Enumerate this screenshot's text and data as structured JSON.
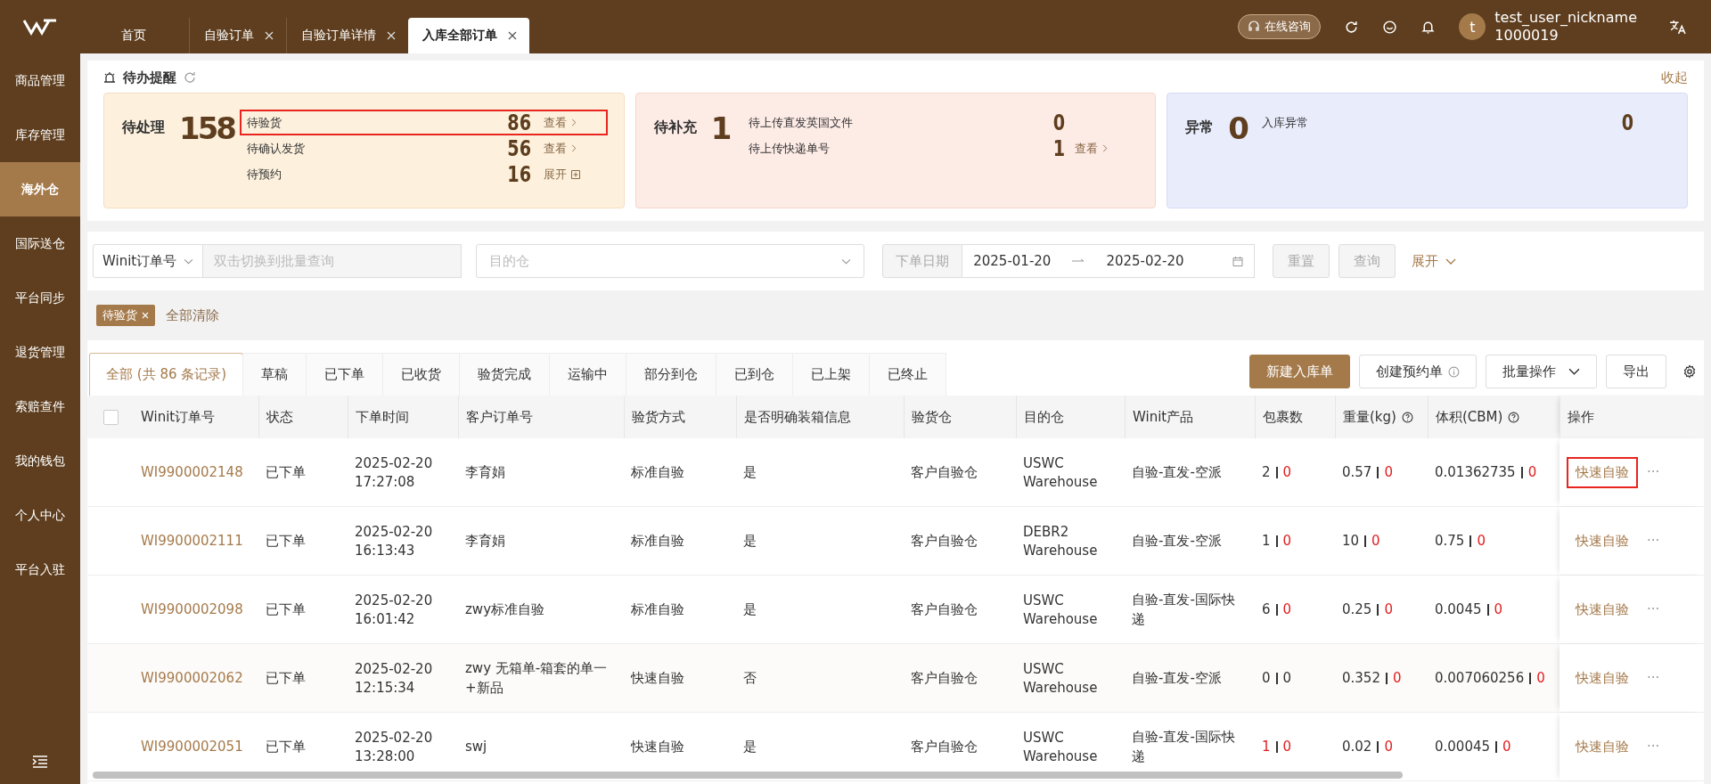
{
  "topbar": {
    "tabs": [
      {
        "label": "首页",
        "closable": false,
        "selected": false
      },
      {
        "label": "自验订单",
        "closable": true,
        "selected": false
      },
      {
        "label": "自验订单详情",
        "closable": true,
        "selected": false
      },
      {
        "label": "入库全部订单",
        "closable": true,
        "selected": true
      }
    ],
    "consult": "在线咨询",
    "user": {
      "avatar": "t",
      "name": "test_user_nickname",
      "id": "1000019"
    }
  },
  "sidebar": {
    "items": [
      {
        "label": "商品管理",
        "selected": false
      },
      {
        "label": "库存管理",
        "selected": false
      },
      {
        "label": "海外仓",
        "selected": true
      },
      {
        "label": "国际送仓",
        "selected": false
      },
      {
        "label": "平台同步",
        "selected": false
      },
      {
        "label": "退货管理",
        "selected": false
      },
      {
        "label": "索赔查件",
        "selected": false
      },
      {
        "label": "我的钱包",
        "selected": false
      },
      {
        "label": "个人中心",
        "selected": false
      },
      {
        "label": "平台入驻",
        "selected": false
      }
    ]
  },
  "todo": {
    "title": "待办提醒",
    "collapse": "收起",
    "cards": [
      {
        "kind": "pending",
        "label": "待处理",
        "total": "158",
        "items": [
          {
            "label": "待验货",
            "count": "86",
            "action": "查看",
            "kind": "view",
            "highlighted": true
          },
          {
            "label": "待确认发货",
            "count": "56",
            "action": "查看",
            "kind": "view",
            "highlighted": false
          },
          {
            "label": "待预约",
            "count": "16",
            "action": "展开",
            "kind": "expand",
            "highlighted": false
          }
        ]
      },
      {
        "kind": "supplement",
        "label": "待补充",
        "total": "1",
        "items": [
          {
            "label": "待上传直发英国文件",
            "count": "0",
            "highlighted": false
          },
          {
            "label": "待上传快递单号",
            "count": "1",
            "action": "查看",
            "kind": "view",
            "highlighted": false
          }
        ]
      },
      {
        "kind": "exception",
        "label": "异常",
        "total": "0",
        "items": [
          {
            "label": "入库异常",
            "count": "0",
            "highlighted": false
          }
        ]
      }
    ]
  },
  "filters": {
    "field_select": "Winit订单号",
    "search_placeholder": "双击切换到批量查询",
    "warehouse_placeholder": "目的仓",
    "date_label": "下单日期",
    "date_start": "2025-01-20",
    "date_end": "2025-02-20",
    "reset": {
      "label": "重置",
      "disabled": true
    },
    "query": {
      "label": "查询",
      "disabled": true
    },
    "expand": "展开"
  },
  "active_tags": [
    {
      "label": "待验货"
    }
  ],
  "clear_all": "全部清除",
  "status_tabs": [
    {
      "label": "全部 (共 86 条记录)",
      "selected": true
    },
    {
      "label": "草稿",
      "selected": false
    },
    {
      "label": "已下单",
      "selected": false
    },
    {
      "label": "已收货",
      "selected": false
    },
    {
      "label": "验货完成",
      "selected": false
    },
    {
      "label": "运输中",
      "selected": false
    },
    {
      "label": "部分到仓",
      "selected": false
    },
    {
      "label": "已到仓",
      "selected": false
    },
    {
      "label": "已上架",
      "selected": false
    },
    {
      "label": "已终止",
      "selected": false
    }
  ],
  "actions": [
    {
      "label": "新建入库单",
      "kind": "primary"
    },
    {
      "label": "创建预约单",
      "kind": "info"
    },
    {
      "label": "批量操作",
      "kind": "dropdown"
    },
    {
      "label": "导出",
      "kind": "plain"
    }
  ],
  "table": {
    "select_all": {
      "checked": false
    },
    "columns": [
      {
        "label": "Winit订单号",
        "help": false
      },
      {
        "label": "状态",
        "help": false
      },
      {
        "label": "下单时间",
        "help": false
      },
      {
        "label": "客户订单号",
        "help": false
      },
      {
        "label": "验货方式",
        "help": false
      },
      {
        "label": "是否明确装箱信息",
        "help": false
      },
      {
        "label": "验货仓",
        "help": false
      },
      {
        "label": "目的仓",
        "help": false
      },
      {
        "label": "Winit产品",
        "help": false
      },
      {
        "label": "包裹数",
        "help": false
      },
      {
        "label": "重量(kg)",
        "help": true
      },
      {
        "label": "体积(CBM)",
        "help": true
      },
      {
        "label": "操作",
        "help": false
      }
    ],
    "rows": [
      {
        "order": "WI9900002148",
        "status": "已下单",
        "date": "2025-02-20",
        "time": "17:27:08",
        "customer": "李育娟",
        "method": "标准自验",
        "box_info": "是",
        "inspect_wh": "客户自验仓",
        "dest": "USWC",
        "dest_sub": "Warehouse",
        "product": "自验-直发-空派",
        "parcels": [
          {
            "text": "2",
            "alert": false
          },
          {
            "text": "0",
            "alert": true
          }
        ],
        "weight": [
          {
            "text": "0.57",
            "alert": false
          },
          {
            "text": "0",
            "alert": true
          }
        ],
        "volume": [
          {
            "text": "0.01362735",
            "alert": false
          },
          {
            "text": "0",
            "alert": true
          }
        ],
        "action": "快速自验",
        "highlighted": true,
        "more": "···"
      },
      {
        "order": "WI9900002111",
        "status": "已下单",
        "date": "2025-02-20",
        "time": "16:13:43",
        "customer": "李育娟",
        "method": "标准自验",
        "box_info": "是",
        "inspect_wh": "客户自验仓",
        "dest": "DEBR2",
        "dest_sub": "Warehouse",
        "product": "自验-直发-空派",
        "parcels": [
          {
            "text": "1",
            "alert": false
          },
          {
            "text": "0",
            "alert": true
          }
        ],
        "weight": [
          {
            "text": "10",
            "alert": false
          },
          {
            "text": "0",
            "alert": true
          }
        ],
        "volume": [
          {
            "text": "0.75",
            "alert": false
          },
          {
            "text": "0",
            "alert": true
          }
        ],
        "action": "快速自验",
        "highlighted": false,
        "more": "···"
      },
      {
        "order": "WI9900002098",
        "status": "已下单",
        "date": "2025-02-20",
        "time": "16:01:42",
        "customer": "zwy标准自验",
        "method": "标准自验",
        "box_info": "是",
        "inspect_wh": "客户自验仓",
        "dest": "USWC",
        "dest_sub": "Warehouse",
        "product": "自验-直发-国际快递",
        "parcels": [
          {
            "text": "6",
            "alert": false
          },
          {
            "text": "0",
            "alert": true
          }
        ],
        "weight": [
          {
            "text": "0.25",
            "alert": false
          },
          {
            "text": "0",
            "alert": true
          }
        ],
        "volume": [
          {
            "text": "0.0045",
            "alert": false
          },
          {
            "text": "0",
            "alert": true
          }
        ],
        "action": "快速自验",
        "highlighted": false,
        "more": "···"
      },
      {
        "order": "WI9900002062",
        "status": "已下单",
        "date": "2025-02-20",
        "time": "12:15:34",
        "customer": "zwy 无箱单-箱套的单一+新品",
        "method": "快速自验",
        "box_info": "否",
        "inspect_wh": "客户自验仓",
        "dest": "USWC",
        "dest_sub": "Warehouse",
        "product": "自验-直发-空派",
        "parcels": [
          {
            "text": "0",
            "alert": false
          },
          {
            "text": "0",
            "alert": false
          }
        ],
        "weight": [
          {
            "text": "0.352",
            "alert": false
          },
          {
            "text": "0",
            "alert": true
          }
        ],
        "volume": [
          {
            "text": "0.007060256",
            "alert": false
          },
          {
            "text": "0",
            "alert": true
          }
        ],
        "action": "快速自验",
        "highlighted": false,
        "more": "···"
      },
      {
        "order": "WI9900002051",
        "status": "已下单",
        "date": "2025-02-20",
        "time": "13:28:00",
        "customer": "swj",
        "method": "快速自验",
        "box_info": "是",
        "inspect_wh": "客户自验仓",
        "dest": "USWC",
        "dest_sub": "Warehouse",
        "product": "自验-直发-国际快递",
        "parcels": [
          {
            "text": "1",
            "alert": true
          },
          {
            "text": "0",
            "alert": true
          }
        ],
        "weight": [
          {
            "text": "0.02",
            "alert": false
          },
          {
            "text": "0",
            "alert": true
          }
        ],
        "volume": [
          {
            "text": "0.00045",
            "alert": false
          },
          {
            "text": "0",
            "alert": true
          }
        ],
        "action": "快速自验",
        "highlighted": false,
        "more": "···"
      }
    ]
  }
}
